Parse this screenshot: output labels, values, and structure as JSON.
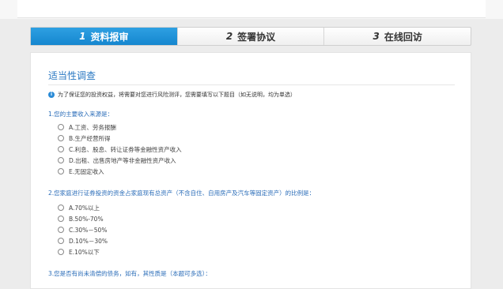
{
  "steps": [
    {
      "num": "1",
      "label": "资料报审",
      "active": true
    },
    {
      "num": "2",
      "label": "签署协议",
      "active": false
    },
    {
      "num": "3",
      "label": "在线回访",
      "active": false
    }
  ],
  "survey": {
    "title": "适当性调查",
    "notice": "为了保证您的投资权益，将需要对您进行风险测评，您需要填写以下题目（如无说明，均为单选）",
    "questions": [
      {
        "text": "1.您的主要收入来源是：",
        "options": [
          "A.工资、劳务报酬",
          "B.生产经营所得",
          "C.利息、股息、转让证券等金融性资产收入",
          "D.出租、出售房地产等非金融性资产收入",
          "E.无固定收入"
        ]
      },
      {
        "text": "2.您家庭进行证券投资的资金占家庭现有总资产（不含自住、自用房产及汽车等固定资产）的比例是：",
        "options": [
          "A.70%以上",
          "B.50%-70%",
          "C.30%－50%",
          "D.10%－30%",
          "E.10%以下"
        ]
      },
      {
        "text": "3.您是否有尚未清偿的债务，如有，其性质是（本题可多选）："
      }
    ]
  }
}
